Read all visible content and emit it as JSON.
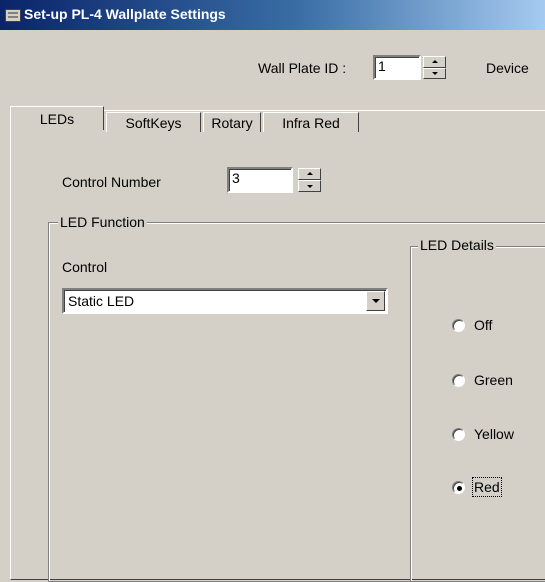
{
  "window": {
    "title": "Set-up PL-4 Wallplate Settings"
  },
  "header": {
    "wallplate_id_label": "Wall Plate ID :",
    "wallplate_id_value": "1",
    "device_label": "Device"
  },
  "tabs": [
    {
      "label": "LEDs",
      "active": true
    },
    {
      "label": "SoftKeys",
      "active": false
    },
    {
      "label": "Rotary",
      "active": false
    },
    {
      "label": "Infra Red",
      "active": false
    }
  ],
  "control_number": {
    "label": "Control Number",
    "value": "3"
  },
  "led_function": {
    "group_title": "LED Function",
    "control_label": "Control",
    "control_value": "Static LED"
  },
  "led_details": {
    "group_title": "LED Details",
    "options": [
      {
        "label": "Off",
        "checked": false
      },
      {
        "label": "Green",
        "checked": false
      },
      {
        "label": "Yellow",
        "checked": false
      },
      {
        "label": "Red",
        "checked": true
      }
    ]
  }
}
